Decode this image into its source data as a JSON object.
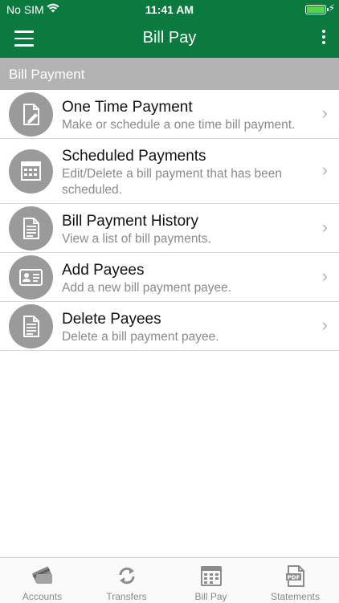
{
  "status": {
    "carrier": "No SIM",
    "time": "11:41 AM"
  },
  "nav": {
    "title": "Bill Pay"
  },
  "section": {
    "title": "Bill Payment"
  },
  "items": [
    {
      "title": "One Time Payment",
      "subtitle": "Make or schedule a one time bill payment.",
      "icon": "document-pen-icon"
    },
    {
      "title": "Scheduled Payments",
      "subtitle": "Edit/Delete a bill payment that has been scheduled.",
      "icon": "calendar-icon"
    },
    {
      "title": "Bill Payment History",
      "subtitle": "View a list of bill payments.",
      "icon": "document-list-icon"
    },
    {
      "title": "Add Payees",
      "subtitle": "Add a new bill payment payee.",
      "icon": "id-card-icon"
    },
    {
      "title": "Delete Payees",
      "subtitle": "Delete a bill payment payee.",
      "icon": "document-list-icon"
    }
  ],
  "tabs": [
    {
      "label": "Accounts",
      "icon": "cards-icon"
    },
    {
      "label": "Transfers",
      "icon": "refresh-icon"
    },
    {
      "label": "Bill Pay",
      "icon": "calendar-icon"
    },
    {
      "label": "Statements",
      "icon": "pdf-icon"
    }
  ],
  "colors": {
    "brand": "#0b7a3e",
    "section": "#b3b3b3",
    "icon_bg": "#9a9a9a"
  }
}
